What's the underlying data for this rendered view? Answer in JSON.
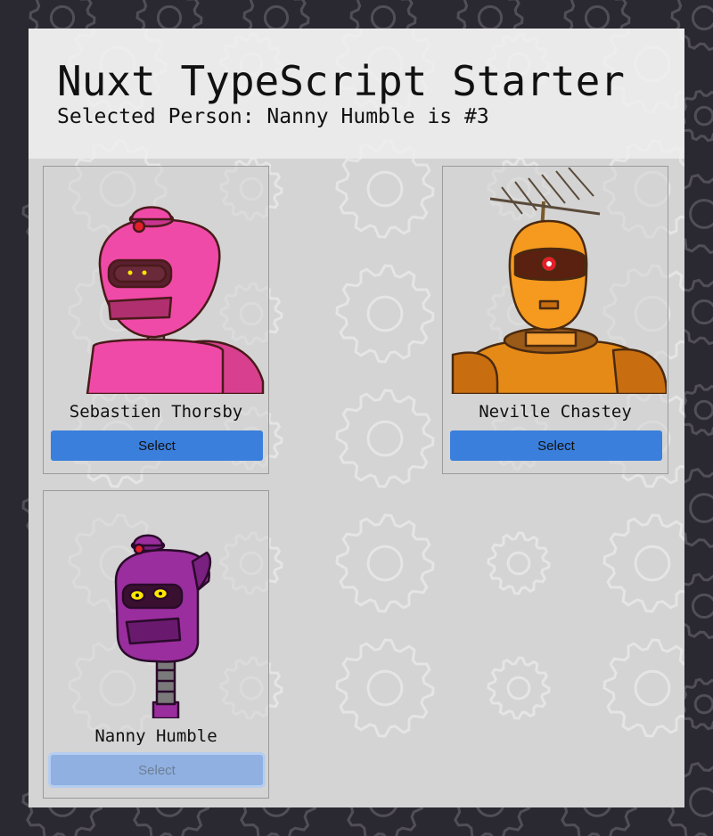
{
  "header": {
    "title": "Nuxt TypeScript Starter",
    "selected_prefix": "Selected Person:",
    "selected_name": "Nanny Humble",
    "selected_suffix": "is #3"
  },
  "people": [
    {
      "name": "Sebastien Thorsby",
      "button_label": "Select",
      "disabled": false,
      "robot_color": "#f04aa8"
    },
    {
      "name": "Neville Chastey",
      "button_label": "Select",
      "disabled": false,
      "robot_color": "#f59a1f"
    },
    {
      "name": "Nanny Humble",
      "button_label": "Select",
      "disabled": true,
      "robot_color": "#9a2e9e"
    }
  ],
  "colors": {
    "page_bg": "#2a2830",
    "panel_bg": "#d4d4d4",
    "button": "#3a7fdc"
  }
}
